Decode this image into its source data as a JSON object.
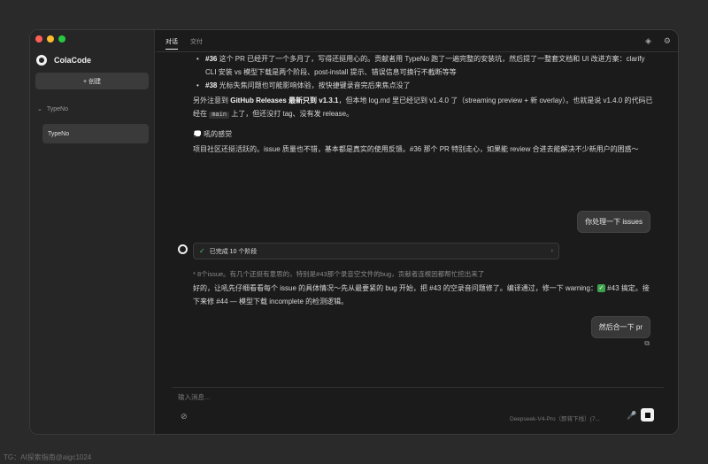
{
  "sidebar": {
    "brand": "ColaCode",
    "new_button": "+ 创建",
    "project": "TypeNo",
    "project_chevron": "⌄",
    "session": "TypeNo"
  },
  "tabs": [
    {
      "label": "对话",
      "active": true
    },
    {
      "label": "交付",
      "active": false
    }
  ],
  "top_icons": [
    "layers-icon",
    "gear-icon"
  ],
  "conversation": {
    "bullets": [
      {
        "bold": "#36",
        "text": " 这个 PR 已经开了一个多月了，写得还挺用心的。贡献者用 TypeNo 跑了一遍完整的安装坑，然后提了一整套文档和 UI 改进方案：clarify CLI 安装 vs 模型下载是两个阶段、post-install 提示、错误信息可换行不截断等等"
      },
      {
        "bold": "#38",
        "text": " 光标失焦问题也可能影响体验，按快捷键录音完后来焦点没了"
      }
    ],
    "release_para_pre": "另外注意到 ",
    "release_para_bold": "GitHub Releases 最新只到 v1.3.1",
    "release_para_mid": "，但本地 log.md 里已经记到 v1.4.0 了（streaming preview + 新 overlay）。也就是说 v1.4.0 的代码已经在 ",
    "release_para_code": "main",
    "release_para_post": " 上了，但还没打 tag、没有发 release。",
    "feeling_title": "💭 吼的感觉",
    "feeling_para": "项目社区还挺活跃的。issue 质量也不错，基本都是真实的使用反馈。#36 那个 PR 特别走心，如果能 review 合进去能解决不少新用户的困惑～",
    "user_msg_1": "你处理一下 issues",
    "stage_check": "✓",
    "stage_label": "已完成 10 个阶段",
    "stage_chevron": "›",
    "thinking": "* 8个issue。有几个还挺有意思的，特别是#43那个录音空文件的bug，贡献者连根因都帮忙挖出来了",
    "reply_pre": "好的，让吼先仔细看看每个 issue 的具体情况～先从最要紧的 bug 开始，把 #43 的空录音问题修了。编译通过，修一下 warning：",
    "reply_check": "✓",
    "reply_post": " #43 搞定。接下来修 #44 — 模型下载 incomplete 的检测逻辑。",
    "user_msg_2": "然后合一下 pr",
    "copy_glyph": "⧉"
  },
  "composer": {
    "placeholder": "输入消息...",
    "attach_glyph": "⊘",
    "model": "Deepseek-V4-Pro（即将下线）(7...",
    "mic_glyph": "🎤"
  },
  "watermark": "TG：AI探索指南@aigc1024",
  "colors": {
    "window_bg": "#1b1b1b",
    "sidebar_bg": "#262626",
    "bubble_bg": "#383838",
    "success": "#3fa34d"
  }
}
